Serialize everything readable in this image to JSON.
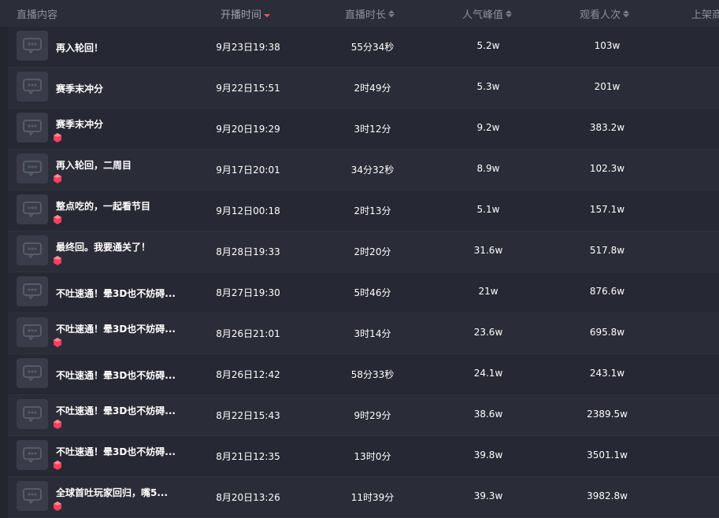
{
  "header": {
    "content": "直播内容",
    "start_time": "开播时间",
    "duration": "直播时长",
    "peak": "人气峰值",
    "views": "观看人次",
    "listed": "上架商"
  },
  "sort_active_column": "start_time",
  "sort_direction": "desc",
  "colors": {
    "background": "#23252f",
    "header_bg": "#2b2e39",
    "sort_active": "#ff4f6a",
    "gem": "#ff3f5c"
  },
  "rows": [
    {
      "title": "再入轮回！",
      "start": "9月23日19:38",
      "duration": "55分34秒",
      "peak": "5.2w",
      "views": "103w",
      "gem": false
    },
    {
      "title": "赛季末冲分",
      "start": "9月22日15:51",
      "duration": "2时49分",
      "peak": "5.3w",
      "views": "201w",
      "gem": false
    },
    {
      "title": "赛季末冲分",
      "start": "9月20日19:29",
      "duration": "3时12分",
      "peak": "9.2w",
      "views": "383.2w",
      "gem": true
    },
    {
      "title": "再入轮回，二周目",
      "start": "9月17日20:01",
      "duration": "34分32秒",
      "peak": "8.9w",
      "views": "102.3w",
      "gem": true
    },
    {
      "title": "整点吃的，一起看节目",
      "start": "9月12日00:18",
      "duration": "2时13分",
      "peak": "5.1w",
      "views": "157.1w",
      "gem": true
    },
    {
      "title": "最终回。我要通关了！",
      "start": "8月28日19:33",
      "duration": "2时20分",
      "peak": "31.6w",
      "views": "517.8w",
      "gem": true
    },
    {
      "title": "不吐速通！晕3D也不妨碍...",
      "start": "8月27日19:30",
      "duration": "5时46分",
      "peak": "21w",
      "views": "876.6w",
      "gem": false
    },
    {
      "title": "不吐速通！晕3D也不妨碍...",
      "start": "8月26日21:01",
      "duration": "3时14分",
      "peak": "23.6w",
      "views": "695.8w",
      "gem": true
    },
    {
      "title": "不吐速通！晕3D也不妨碍...",
      "start": "8月26日12:42",
      "duration": "58分33秒",
      "peak": "24.1w",
      "views": "243.1w",
      "gem": false
    },
    {
      "title": "不吐速通！晕3D也不妨碍...",
      "start": "8月22日15:43",
      "duration": "9时29分",
      "peak": "38.6w",
      "views": "2389.5w",
      "gem": true
    },
    {
      "title": "不吐速通！晕3D也不妨碍...",
      "start": "8月21日12:35",
      "duration": "13时0分",
      "peak": "39.8w",
      "views": "3501.1w",
      "gem": true
    },
    {
      "title": "全球首吐玩家回归，嘴5...",
      "start": "8月20日13:26",
      "duration": "11时39分",
      "peak": "39.3w",
      "views": "3982.8w",
      "gem": true
    }
  ]
}
